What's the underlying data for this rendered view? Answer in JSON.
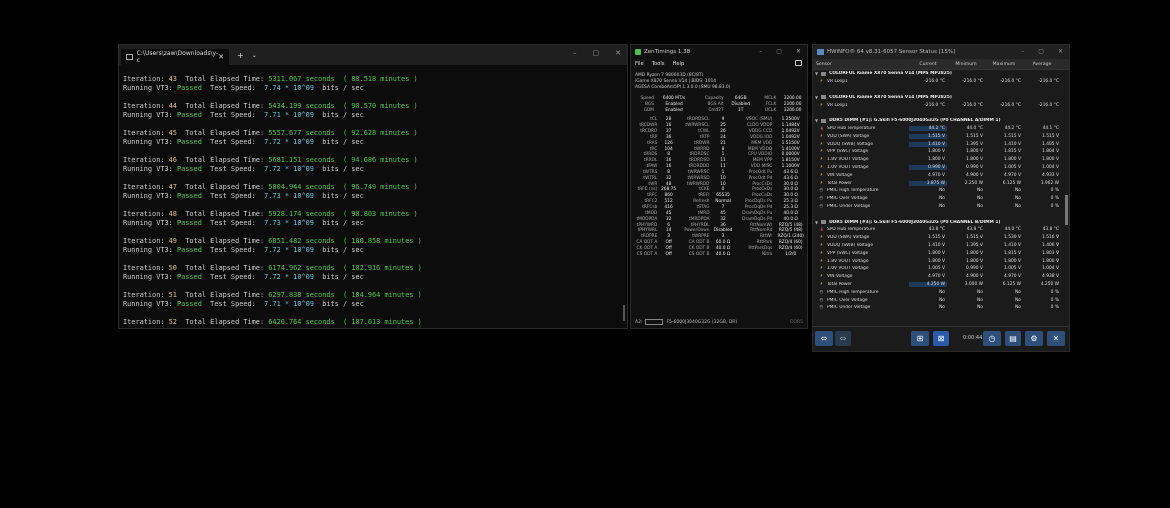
{
  "terminal": {
    "tab_title": "C:\\Users\\zaw\\Downloads\\y-c",
    "new_tab": "+",
    "dropdown": "⌄",
    "min": "–",
    "max": "▢",
    "close": "✕",
    "iterations": [
      {
        "n": "43",
        "time": "5311.067 seconds",
        "minutes": "( 88.518 minutes )",
        "speed": "7.74 * 10^09"
      },
      {
        "n": "44",
        "time": "5434.199 seconds",
        "minutes": "( 90.570 minutes )",
        "speed": "7.71 * 10^09"
      },
      {
        "n": "45",
        "time": "5557.677 seconds",
        "minutes": "( 92.628 minutes )",
        "speed": "7.72 * 10^09"
      },
      {
        "n": "46",
        "time": "5681.151 seconds",
        "minutes": "( 94.686 minutes )",
        "speed": "7.72 * 10^09"
      },
      {
        "n": "47",
        "time": "5804.944 seconds",
        "minutes": "( 96.749 minutes )",
        "speed": "7.73 * 10^09"
      },
      {
        "n": "48",
        "time": "5928.174 seconds",
        "minutes": "( 98.803 minutes )",
        "speed": "7.73 * 10^09"
      },
      {
        "n": "49",
        "time": "6051.482 seconds",
        "minutes": "( 100.858 minutes )",
        "speed": "7.72 * 10^09"
      },
      {
        "n": "50",
        "time": "6174.962 seconds",
        "minutes": "( 102.916 minutes )",
        "speed": "7.72 * 10^09"
      },
      {
        "n": "51",
        "time": "6297.838 seconds",
        "minutes": "( 104.964 minutes )",
        "speed": "7.71 * 10^09"
      }
    ],
    "last": {
      "n": "52",
      "time": "6420.764 seconds",
      "minutes": "( 107.013 minutes )"
    },
    "label_iteration": "Iteration:",
    "label_total": "Total Elapsed Time:",
    "label_running": "Running VT3:",
    "label_passed": "Passed",
    "label_testspeed": "Test Speed:",
    "label_unit": "bits / sec"
  },
  "zen": {
    "title": "ZenTimings 1.38",
    "menu": [
      "File",
      "Tools",
      "Help"
    ],
    "cpu": "AMD Ryzen 7 9800X3D (8C/8T)",
    "board": "iGame X870 Senna V14 | BIOS: 1014",
    "agesa": "AGESA ComboAm5PI 1.3.0.0 (SMU 98.83.0)",
    "top_rows": [
      [
        "Speed",
        "6400 MT/s",
        "Capacity",
        "64GB",
        "MCLK",
        "3200.00"
      ],
      [
        "BGS",
        "Enabled",
        "BGS Alt",
        "Disabled",
        "FCLK",
        "2200.00"
      ],
      [
        "GDM",
        "Enabled",
        "Cmd2T",
        "1T",
        "UCLK",
        "3200.00"
      ]
    ],
    "rows": [
      [
        "tCL",
        "28",
        "tRDRDSCL",
        "9",
        "VSOC (SMU)",
        "1.2500V"
      ],
      [
        "tRCDWR",
        "16",
        "tWRWRSCL",
        "25",
        "CLDO VDDP",
        "1.1484V"
      ],
      [
        "tRCDRD",
        "37",
        "tCWL",
        "26",
        "VDDG CCD",
        "1.0492V"
      ],
      [
        "tRP",
        "36",
        "tRTP",
        "24",
        "VDDG IOD",
        "1.0492V"
      ],
      [
        "tRAS",
        "126",
        "tRDWR",
        "21",
        "MEM VDD",
        "1.5150V"
      ],
      [
        "tRC",
        "104",
        "tWRRD",
        "8",
        "MEM VDDQ",
        "1.4100V"
      ],
      [
        "tRRDS",
        "8",
        "tRDRDSC",
        "1",
        "CPU VDDIO",
        "0.0000V"
      ],
      [
        "tRRDL",
        "16",
        "tRDRDSD",
        "11",
        "MEM VPP",
        "1.8150V"
      ],
      [
        "tFAW",
        "16",
        "tRDRDDD",
        "11",
        "VDD MISC",
        "1.1000V"
      ],
      [
        "tWTRS",
        "8",
        "tWRWRSC",
        "1",
        "ProcOdt Pu",
        "43.6 Ω"
      ],
      [
        "tWTRL",
        "32",
        "tWRWRSD",
        "10",
        "ProcOdt Pd",
        "43.6 Ω"
      ],
      [
        "tWR",
        "48",
        "tWRWRDD",
        "10",
        "ProcCsDs",
        "30.0 Ω"
      ],
      [
        "tRFC (ns)",
        "268.75",
        "tCKE",
        "0",
        "ProcCkDs",
        "30.0 Ω"
      ],
      [
        "tRFC",
        "860",
        "tREFI",
        "65535",
        "ProcCaDs",
        "30.0 Ω"
      ],
      [
        "tRFC2",
        "512",
        "Refresh",
        "Normal",
        "ProcDqDs Pu",
        "25.3 Ω"
      ],
      [
        "tRFCsb",
        "416",
        "tSTAG",
        "7",
        "ProcDqDs Pd",
        "25.3 Ω"
      ],
      [
        "tMOD",
        "45",
        "tMRD",
        "45",
        "DramDqDs Pu",
        "40.0 Ω"
      ],
      [
        "tMODPDA",
        "32",
        "tMRDPDA",
        "32",
        "DramDqDs Pd",
        "40.0 Ω"
      ],
      [
        "tPHYWRD",
        "6",
        "tPHYRDL",
        "36",
        "RttNomWr",
        "RZQ/5 (48)"
      ],
      [
        "tPHYWRL",
        "14",
        "PowerDown",
        "Disabled",
        "RttNomRd",
        "RZQ/5 (48)"
      ],
      [
        "tRDPRE",
        "3",
        "tWRPRE",
        "3",
        "RttWr",
        "RZQ/1 (240)"
      ],
      [
        "CA ODT A",
        "Off",
        "CA ODT B",
        "60.0 Ω",
        "RttPark",
        "RZQ/4 (60)"
      ],
      [
        "CK ODT A",
        "Off",
        "CK ODT B",
        "40.0 Ω",
        "RttParkDqs",
        "RZQ/4 (60)"
      ],
      [
        "CS ODT A",
        "Off",
        "CS ODT B",
        "40.0 Ω",
        "Nitro",
        "1/2/0"
      ]
    ],
    "foot_slot": "A2:",
    "foot_module": "F5-6000J3040G32G (32GB, DR)",
    "foot_dd": "DDR5"
  },
  "hw": {
    "title": "HWiNFO® 64 v8.31-6057 Sensor Status [15%]",
    "columns": [
      "Sensor",
      "Current",
      "Minimum",
      "Maximum",
      "Average"
    ],
    "sections": [
      {
        "group": "COLORFUL iGame X870 Senna V14 (MPS MP2825)",
        "rows": [
          {
            "icon": "volt",
            "label": "VR Loop1",
            "cur": "-216.0 °C",
            "min": "-216.0 °C",
            "max": "-216.0 °C",
            "avg": "-216.0 °C"
          }
        ]
      },
      {
        "group": "COLORFUL iGame X870 Senna V14 (MPS MP2825)",
        "rows": [
          {
            "icon": "volt",
            "label": "VR Loop1",
            "cur": "-216.0 °C",
            "min": "-216.0 °C",
            "max": "-216.0 °C",
            "avg": "-216.0 °C"
          }
        ]
      },
      {
        "group": "DDR5 DIMM [#1]: G.Skill F5-6000J3040G32G (P0 CHANNEL A/DIMM 1)",
        "rows": [
          {
            "icon": "temp",
            "label": "SPD Hub Temperature",
            "cur": "44.2 °C",
            "min": "44.0 °C",
            "max": "44.2 °C",
            "avg": "44.1 °C",
            "hl": true
          },
          {
            "icon": "volt",
            "label": "VDD (SWA) Voltage",
            "cur": "1.515 V",
            "min": "1.515 V",
            "max": "1.515 V",
            "avg": "1.515 V",
            "hl": true
          },
          {
            "icon": "volt",
            "label": "VDDQ (SWB) Voltage",
            "cur": "1.410 V",
            "min": "1.395 V",
            "max": "1.410 V",
            "avg": "1.405 V",
            "hl": true
          },
          {
            "icon": "volt",
            "label": "VPP (SWC) Voltage",
            "cur": "1.800 V",
            "min": "1.800 V",
            "max": "1.815 V",
            "avg": "1.804 V"
          },
          {
            "icon": "volt",
            "label": "1.8V VOUT Voltage",
            "cur": "1.800 V",
            "min": "1.800 V",
            "max": "1.800 V",
            "avg": "1.800 V"
          },
          {
            "icon": "volt",
            "label": "1.0V VOUT Voltage",
            "cur": "0.990 V",
            "min": "0.990 V",
            "max": "1.005 V",
            "avg": "1.004 V",
            "hl": true
          },
          {
            "icon": "volt",
            "label": "VIN Voltage",
            "cur": "4.970 V",
            "min": "4.900 V",
            "max": "4.970 V",
            "avg": "4.933 V"
          },
          {
            "icon": "volt",
            "label": "Total Power",
            "cur": "3.875 W",
            "min": "2.250 W",
            "max": "6.125 W",
            "avg": "3.962 W",
            "hl": true
          },
          {
            "icon": "other",
            "label": "PMIC High Temperature",
            "cur": "No",
            "min": "No",
            "max": "No",
            "avg": "0 %"
          },
          {
            "icon": "other",
            "label": "PMIC Over Voltage",
            "cur": "No",
            "min": "No",
            "max": "No",
            "avg": "0 %"
          },
          {
            "icon": "other",
            "label": "PMIC Under Voltage",
            "cur": "No",
            "min": "No",
            "max": "No",
            "avg": "0 %"
          }
        ]
      },
      {
        "group": "DDR5 DIMM [#3]: G.Skill F5-6000J3040G32G (P0 CHANNEL B/DIMM 1)",
        "rows": [
          {
            "icon": "temp",
            "label": "SPD Hub Temperature",
            "cur": "43.8 °C",
            "min": "43.8 °C",
            "max": "44.0 °C",
            "avg": "43.8 °C"
          },
          {
            "icon": "volt",
            "label": "VDD (SWA) Voltage",
            "cur": "1.515 V",
            "min": "1.515 V",
            "max": "1.530 V",
            "avg": "1.516 V"
          },
          {
            "icon": "volt",
            "label": "VDDQ (SWB) Voltage",
            "cur": "1.410 V",
            "min": "1.395 V",
            "max": "1.410 V",
            "avg": "1.406 V"
          },
          {
            "icon": "volt",
            "label": "VPP (SWC) Voltage",
            "cur": "1.800 V",
            "min": "1.800 V",
            "max": "1.815 V",
            "avg": "1.803 V"
          },
          {
            "icon": "volt",
            "label": "1.8V VOUT Voltage",
            "cur": "1.800 V",
            "min": "1.800 V",
            "max": "1.800 V",
            "avg": "1.800 V"
          },
          {
            "icon": "volt",
            "label": "1.0V VOUT Voltage",
            "cur": "1.005 V",
            "min": "0.990 V",
            "max": "1.005 V",
            "avg": "1.004 V"
          },
          {
            "icon": "volt",
            "label": "VIN Voltage",
            "cur": "4.970 V",
            "min": "4.900 V",
            "max": "4.970 V",
            "avg": "4.938 V"
          },
          {
            "icon": "volt",
            "label": "Total Power",
            "cur": "4.250 W",
            "min": "3.000 W",
            "max": "6.125 W",
            "avg": "4.250 W",
            "hl": true
          },
          {
            "icon": "other",
            "label": "PMIC High Temperature",
            "cur": "No",
            "min": "No",
            "max": "No",
            "avg": "0 %"
          },
          {
            "icon": "other",
            "label": "PMIC Over Voltage",
            "cur": "No",
            "min": "No",
            "max": "No",
            "avg": "0 %"
          },
          {
            "icon": "other",
            "label": "PMIC Under Voltage",
            "cur": "No",
            "min": "No",
            "max": "No",
            "avg": "0 %"
          }
        ]
      }
    ],
    "timer": "0:00:44",
    "toolbar_icons": [
      "arrows-left-right-icon",
      "arrows-left-right-dim-icon",
      "network-icon",
      "reset-icon",
      "clock-icon",
      "report-icon",
      "gear-icon",
      "close-icon"
    ]
  }
}
